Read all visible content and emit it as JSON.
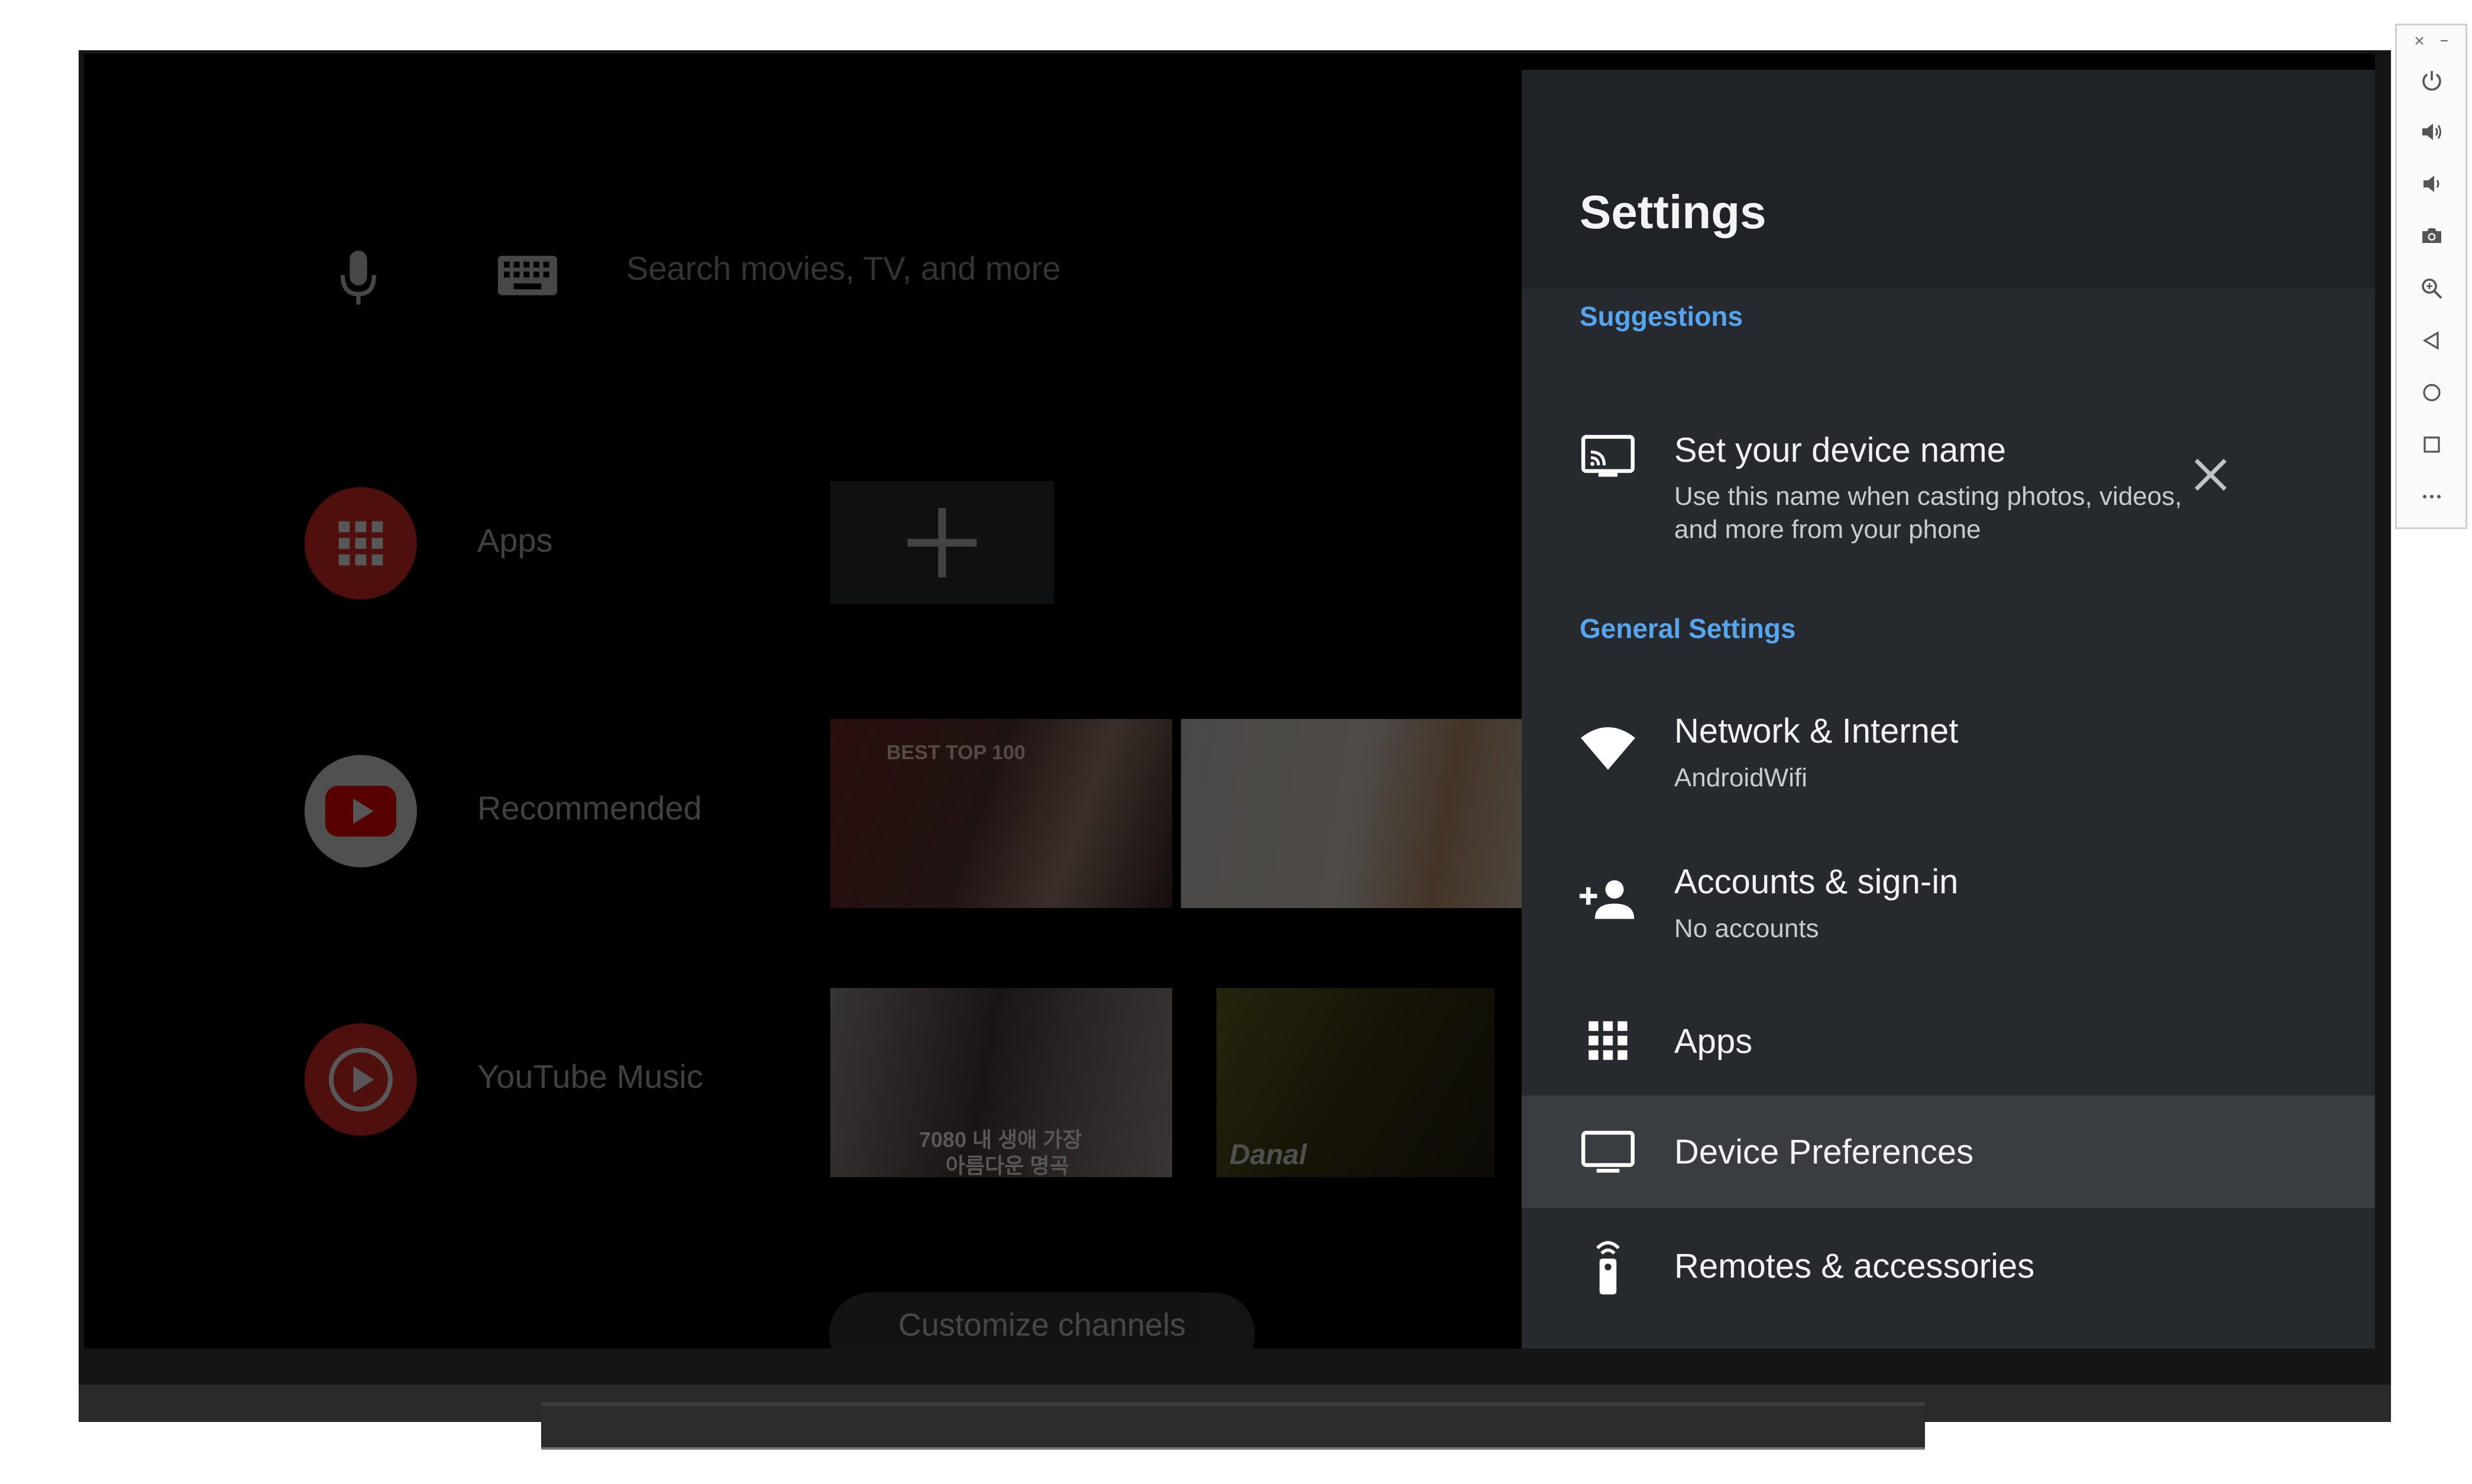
{
  "home": {
    "search_placeholder": "Search movies, TV, and more",
    "rows": [
      {
        "label": "Apps",
        "icon": "apps-grid-icon"
      },
      {
        "label": "Recommended",
        "icon": "youtube-icon"
      },
      {
        "label": "YouTube Music",
        "icon": "youtube-music-icon"
      }
    ],
    "customize_label": "Customize channels",
    "thumb_captions": [
      "BEST TOP 100",
      "7080 내 생애 가장",
      "아름다운 명곡",
      "Danal"
    ]
  },
  "settings": {
    "title": "Settings",
    "sections": {
      "suggestions": "Suggestions",
      "general": "General Settings"
    },
    "suggestion": {
      "title": "Set your device name",
      "subtitle_line1": "Use this name when casting photos, videos,",
      "subtitle_line2": "and more from your phone",
      "icon": "cast-icon"
    },
    "items": [
      {
        "title": "Network & Internet",
        "subtitle": "AndroidWifi",
        "icon": "wifi-icon"
      },
      {
        "title": "Accounts & sign-in",
        "subtitle": "No accounts",
        "icon": "person-add-icon"
      },
      {
        "title": "Apps",
        "icon": "apps-grid-icon"
      },
      {
        "title": "Device Preferences",
        "icon": "tv-icon",
        "focused": true
      },
      {
        "title": "Remotes & accessories",
        "icon": "remote-icon"
      }
    ]
  },
  "emulator_toolbar": [
    "close-icon",
    "minimize-icon",
    "power-icon",
    "volume-up-icon",
    "volume-down-icon",
    "camera-icon",
    "zoom-icon",
    "back-icon",
    "home-icon",
    "overview-icon",
    "more-icon"
  ],
  "colors": {
    "accent": "#57a5ee",
    "panel": "#262a2e",
    "focused_row": "#393d41",
    "youtube_red": "#ff0000"
  }
}
